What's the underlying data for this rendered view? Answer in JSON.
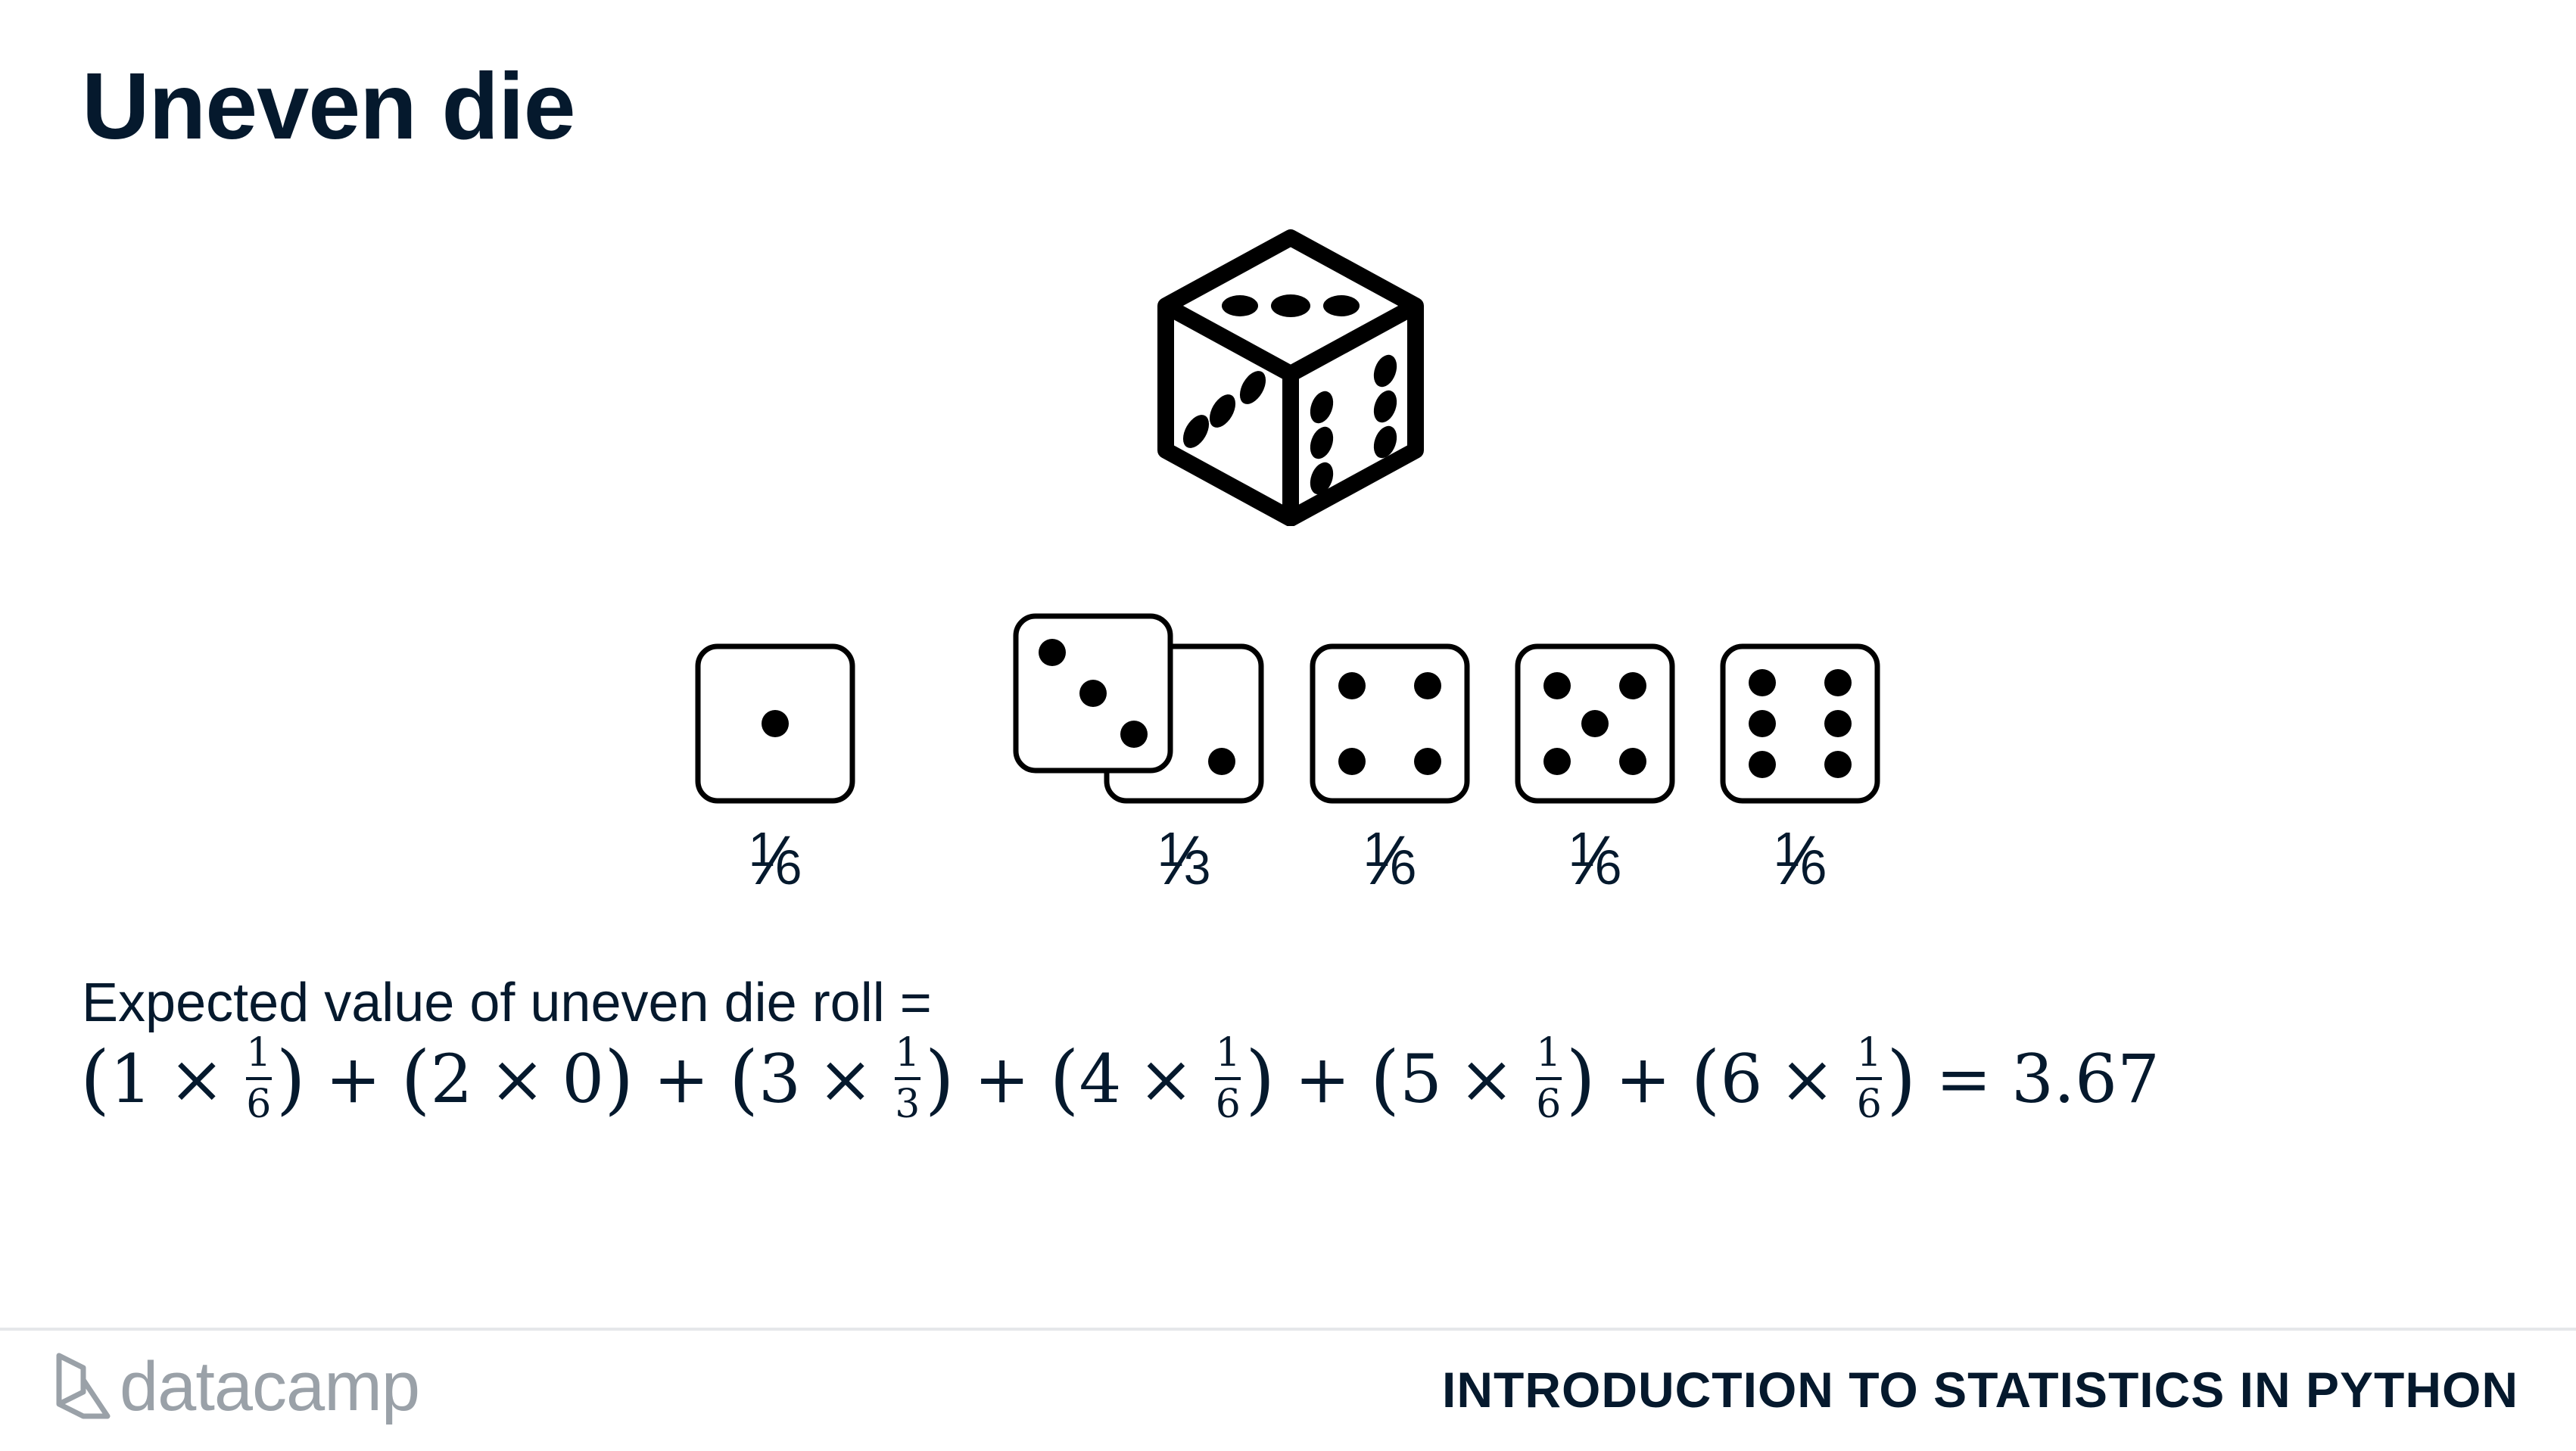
{
  "slide": {
    "title": "Uneven die"
  },
  "faces": [
    {
      "pips": 1,
      "prob": {
        "num": "1",
        "den": "6"
      }
    },
    {
      "pips": 2,
      "prob": null
    },
    {
      "pips": 3,
      "prob": {
        "num": "1",
        "den": "3"
      }
    },
    {
      "pips": 4,
      "prob": {
        "num": "1",
        "den": "6"
      }
    },
    {
      "pips": 5,
      "prob": {
        "num": "1",
        "den": "6"
      }
    },
    {
      "pips": 6,
      "prob": {
        "num": "1",
        "den": "6"
      }
    }
  ],
  "expected_value": {
    "label": "Expected value of uneven die roll =",
    "terms": [
      {
        "face": "1",
        "num": "1",
        "den": "6"
      },
      {
        "face": "2",
        "whole": "0"
      },
      {
        "face": "3",
        "num": "1",
        "den": "3"
      },
      {
        "face": "4",
        "num": "1",
        "den": "6"
      },
      {
        "face": "5",
        "num": "1",
        "den": "6"
      },
      {
        "face": "6",
        "num": "1",
        "den": "6"
      }
    ],
    "result": "3.67"
  },
  "footer": {
    "brand": "datacamp",
    "course": "INTRODUCTION TO STATISTICS IN PYTHON"
  },
  "icons": {
    "hero": "die-3d-icon",
    "logo": "datacamp-logo-icon"
  },
  "colors": {
    "text": "#05192d",
    "logo_gray": "#9aa1a8",
    "divider": "#e5e7ea"
  }
}
